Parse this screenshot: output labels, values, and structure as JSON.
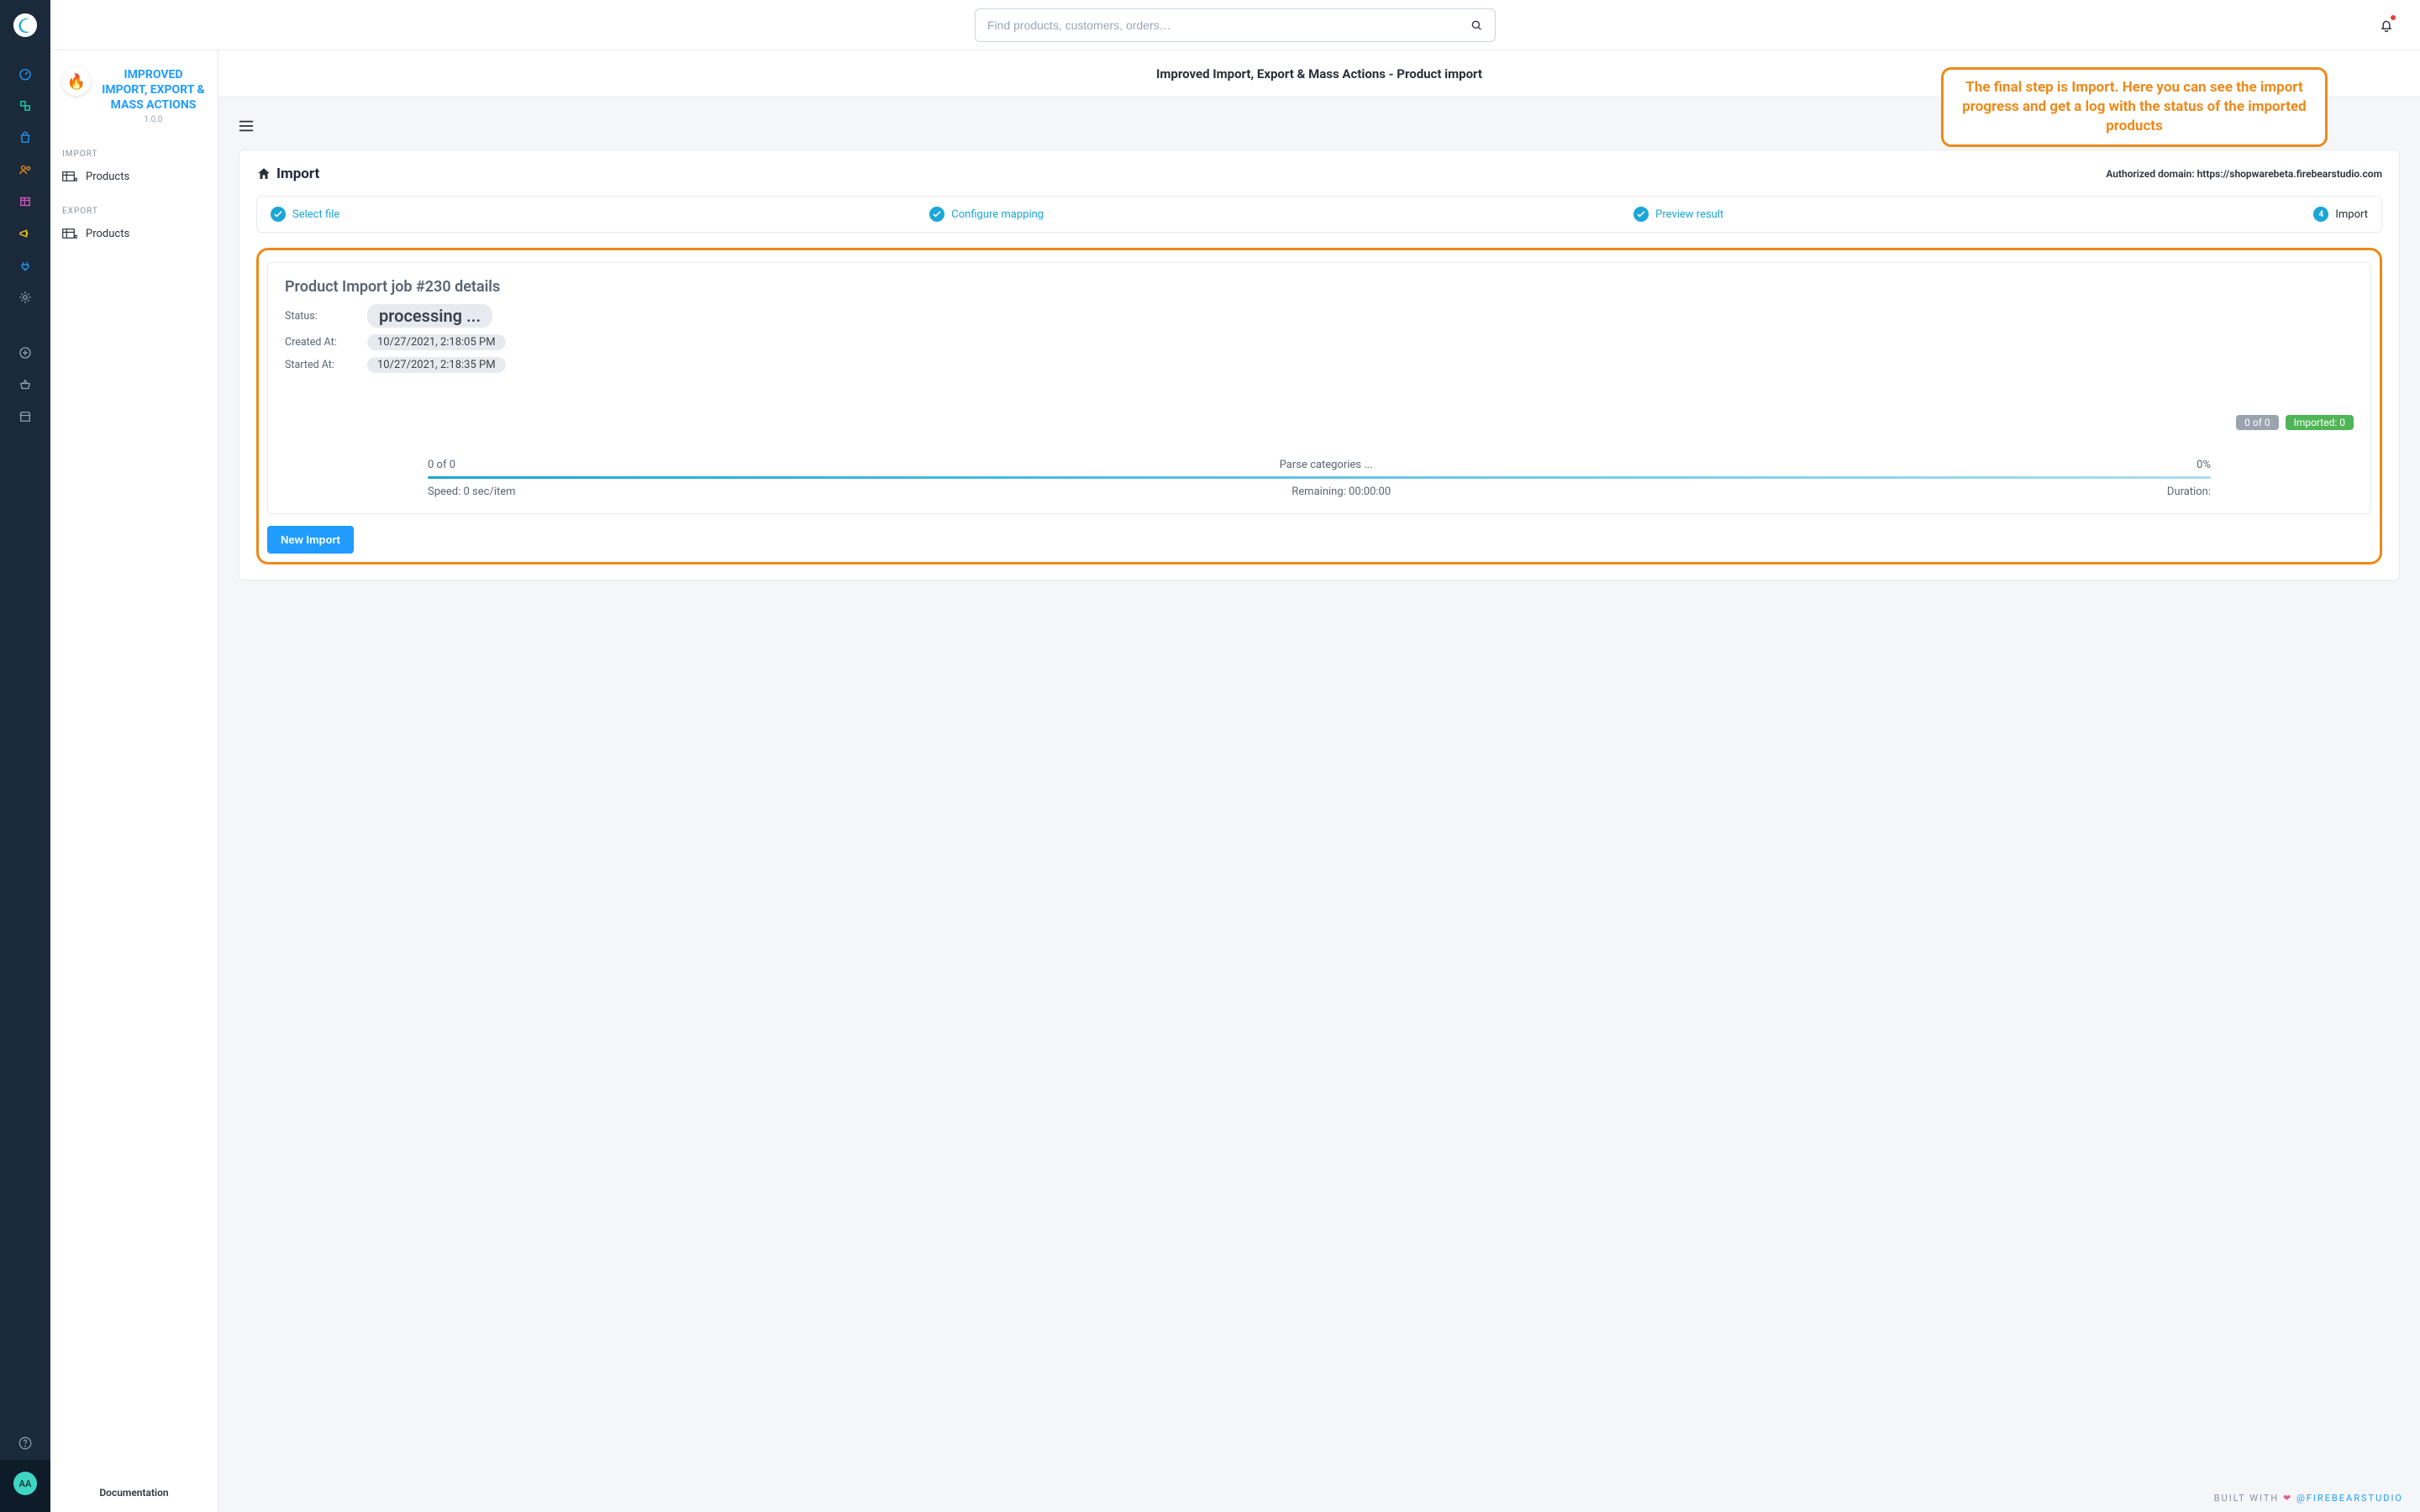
{
  "search": {
    "placeholder": "Find products, customers, orders…"
  },
  "user": {
    "avatar_initials": "AA"
  },
  "sidebar": {
    "title": "IMPROVED IMPORT, EXPORT & MASS ACTIONS",
    "version": "1.0.0",
    "sections": [
      {
        "label": "IMPORT",
        "items": [
          "Products"
        ]
      },
      {
        "label": "EXPORT",
        "items": [
          "Products"
        ]
      }
    ],
    "footer_link": "Documentation"
  },
  "subtitle": "Improved Import, Export & Mass Actions - Product import",
  "callout": "The final step is Import. Here you can see the import progress and get a log with the status of the imported products",
  "page": {
    "title": "Import",
    "auth_domain": "Authorized domain: https://shopwarebeta.firebearstudio.com"
  },
  "stepper": [
    {
      "label": "Select file",
      "state": "completed"
    },
    {
      "label": "Configure mapping",
      "state": "completed"
    },
    {
      "label": "Preview result",
      "state": "completed"
    },
    {
      "label": "Import",
      "state": "active",
      "number": 4
    }
  ],
  "job": {
    "title": "Product Import job #230 details",
    "status_label": "Status:",
    "status_value": "processing ...",
    "created_label": "Created At:",
    "created_value": "10/27/2021, 2:18:05 PM",
    "started_label": "Started  At:",
    "started_value": "10/27/2021, 2:18:35 PM",
    "count_chip": "0 of 0",
    "imported_chip": "Imported: 0",
    "progress": {
      "left": "0 of 0",
      "center": "Parse categories ...",
      "right": "0%",
      "speed": "Speed: 0 sec/item",
      "remaining": "Remaining: 00:00:00",
      "duration": "Duration:"
    }
  },
  "actions": {
    "new_import": "New Import"
  },
  "footer": {
    "built_with": "BUILT WITH",
    "handle": "@FIREBEARSTUDIO"
  },
  "colors": {
    "accent_blue": "#209cff",
    "teal": "#1ba6d6",
    "orange": "#ec8a1a"
  },
  "rail_icons": [
    "gauge-icon",
    "boxes-icon",
    "bag-icon",
    "users-icon",
    "content-icon",
    "megaphone-icon",
    "plug-icon",
    "gear-icon",
    "plus-circle-icon",
    "basket-icon",
    "store-icon"
  ]
}
